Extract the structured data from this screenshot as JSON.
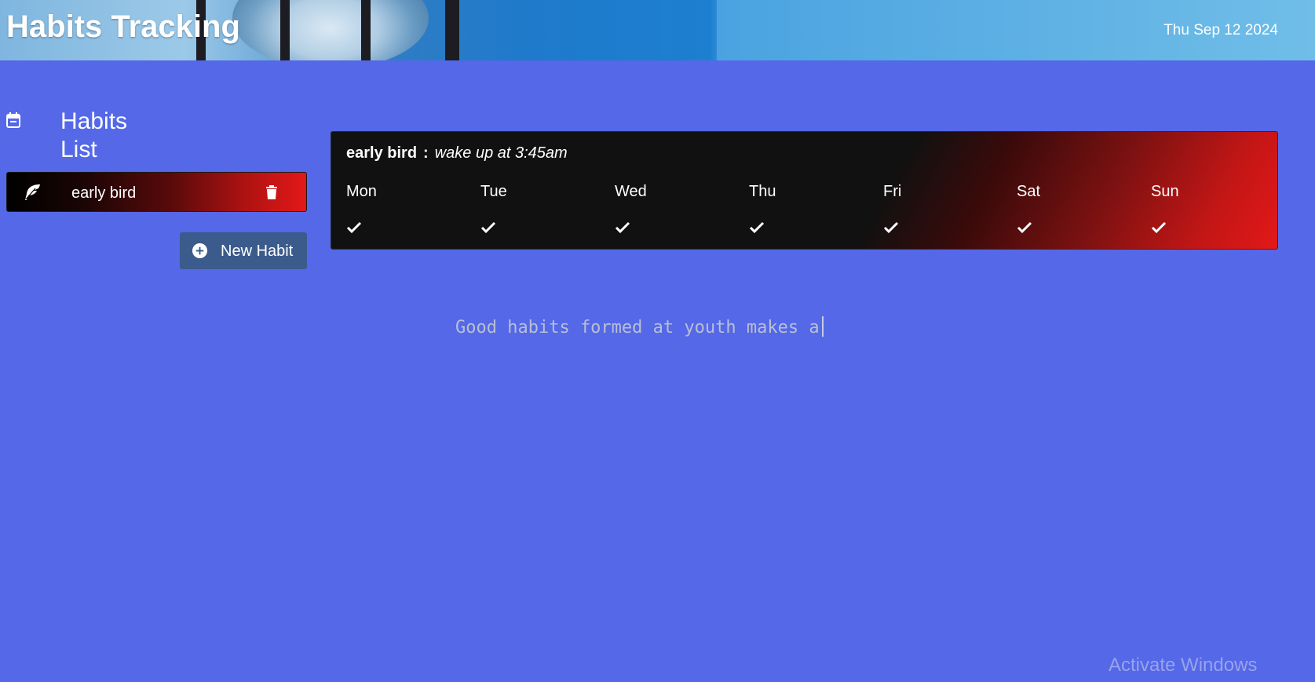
{
  "header": {
    "title": "Habits Tracking",
    "date": "Thu Sep 12 2024"
  },
  "sidebar": {
    "title": "Habits List",
    "title_line1": "Habits",
    "title_line2": "List",
    "habits": [
      {
        "name": "early bird",
        "icon": "leaf-icon"
      }
    ],
    "new_habit_label": "New Habit"
  },
  "habit_card": {
    "name": "early bird",
    "separator": ":",
    "description": "wake up at 3:45am",
    "days": [
      {
        "label": "Mon",
        "checked": true
      },
      {
        "label": "Tue",
        "checked": true
      },
      {
        "label": "Wed",
        "checked": true
      },
      {
        "label": "Thu",
        "checked": true
      },
      {
        "label": "Fri",
        "checked": true
      },
      {
        "label": "Sat",
        "checked": true
      },
      {
        "label": "Sun",
        "checked": true
      }
    ]
  },
  "quote": {
    "text": "Good habits formed at youth makes a"
  },
  "watermark": {
    "text": "Activate Windows"
  },
  "colors": {
    "background": "#5468e8",
    "card_gradient_end": "#e31818",
    "button": "#3b5b8c"
  }
}
